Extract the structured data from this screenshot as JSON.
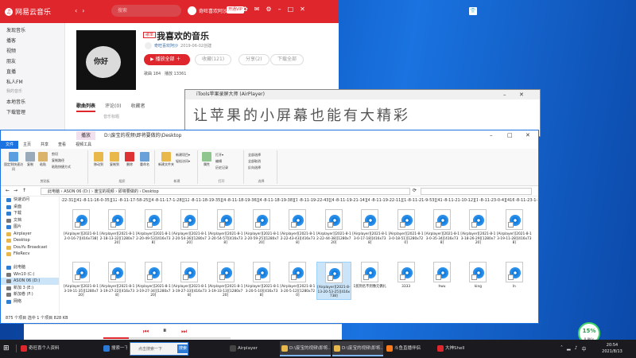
{
  "netease": {
    "app_name": "网易云音乐",
    "nav_back": "‹",
    "nav_fwd": "›",
    "search_placeholder": "搜索",
    "user_name": "奇旺喜欢阿沙",
    "vip": "开通VIP",
    "sidebar": [
      {
        "label": "发现音乐",
        "type": "item"
      },
      {
        "label": "播客",
        "type": "item"
      },
      {
        "label": "视频",
        "type": "item"
      },
      {
        "label": "朋友",
        "type": "item"
      },
      {
        "label": "直播",
        "type": "item"
      },
      {
        "label": "私人FM",
        "type": "item"
      },
      {
        "label": "我的音乐",
        "type": "head"
      },
      {
        "label": "本地音乐",
        "type": "item"
      },
      {
        "label": "下载管理",
        "type": "item"
      }
    ],
    "playlist_badge": "歌单",
    "playlist_title": "我喜欢的音乐",
    "cover_text": "你好",
    "creator": "奇旺喜欢阿沙",
    "create_date": "2019-06-02创建",
    "play_all": "播放全部",
    "collect": "收藏(121)",
    "share": "分享(2)",
    "download_all": "下载全部",
    "stats_songs_label": "歌曲",
    "stats_songs": "184",
    "stats_plays_label": "播放",
    "stats_plays": "13361",
    "tabs": [
      "歌曲列表",
      "评论(0)",
      "收藏者"
    ],
    "sub": "音乐标题"
  },
  "itools": {
    "title": "iTools苹果录屏大师 (AirPlayer)",
    "banner": "让苹果的小屏幕也能有大精彩"
  },
  "explorer": {
    "title_tag": "播放",
    "title_path": "D:\\废宝的视频\\即将要做的\\Desktop",
    "tabs": [
      "文件",
      "主页",
      "共享",
      "查看",
      "视频工具"
    ],
    "ribbon": {
      "clipboard_label": "剪贴板",
      "pin": "固定到快速访问",
      "copy": "复制",
      "paste": "粘贴",
      "cut": "剪切",
      "copy_path": "复制路径",
      "paste_shortcut": "粘贴快捷方式",
      "organize_label": "组织",
      "move_to": "移动到",
      "copy_to": "复制到",
      "delete": "删除",
      "rename": "重命名",
      "new_label": "新建",
      "new_folder": "新建文件夹",
      "new_item": "新建项目▾",
      "easy_access": "轻松访问▾",
      "open_label": "打开",
      "properties": "属性",
      "open": "打开▾",
      "edit": "编辑",
      "history": "历史记录",
      "select_label": "选择",
      "select_all": "全部选择",
      "select_none": "全部取消",
      "invert": "反向选择"
    },
    "breadcrumb": [
      "此电脑",
      "ASON 06 (D:)",
      "废宝的视频",
      "即将要做的",
      "Desktop"
    ],
    "nav": [
      {
        "label": "快速访问",
        "color": "#2d7fd3"
      },
      {
        "label": "桌面",
        "color": "#2d7fd3"
      },
      {
        "label": "下载",
        "color": "#2d7fd3"
      },
      {
        "label": "文档",
        "color": "#777"
      },
      {
        "label": "图片",
        "color": "#2d7fd3"
      },
      {
        "label": "Airplayer",
        "color": "#e8b84a"
      },
      {
        "label": "Desktop",
        "color": "#e8b84a"
      },
      {
        "label": "DouYu Broadcast",
        "color": "#e8b84a"
      },
      {
        "label": "FileRecv",
        "color": "#e8b84a"
      },
      {
        "label": "",
        "color": "transparent"
      },
      {
        "label": "此电脑",
        "color": "#2d7fd3"
      },
      {
        "label": "Win10 (C:)",
        "color": "#777"
      },
      {
        "label": "ASON 06 (D:)",
        "color": "#777"
      },
      {
        "label": "新加 3 (E:)",
        "color": "#777"
      },
      {
        "label": "新加卷 (F:)",
        "color": "#777"
      },
      {
        "label": "网络",
        "color": "#2d7fd3"
      }
    ],
    "top_row": [
      "-8-11-0-22-31][416x738]",
      "-8-11-16-0-35][1280x720]",
      "-8-11-17-58-25][416x738]",
      "-8-11-17-1-28][1280x720]",
      "-8-11-18-19-35][416x738]",
      "-8-11-18-19-36][416x738]",
      "-8-11-18-19-38][1280x720]",
      "-8-11-19-22-43][416x738]",
      "-8-11-19-21-14][416x738]",
      "-8-11-19-22-11][1280x720]",
      "-8-11-21-9-53][416x738]",
      "-8-11-21-10-12][1280x720]",
      "-8-11-23-0-4][416x738]",
      "-8-11-23-1-10][1280x720]"
    ],
    "row1": [
      "[Airplayer][2021-8-12-0-16-7][416x738]",
      "[Airplayer][2021-8-12-18-13-32][1280x720]",
      "[Airplayer][2021-8-12-20-49-53][416x738]",
      "[Airplayer][2021-8-12-20-54-36][1280x720]",
      "[Airplayer][2021-8-12-20-54-57][416x738]",
      "[Airplayer][2021-8-12-20-59-25][1280x720]",
      "[Airplayer][2021-8-12-22-43-43][416x738]",
      "[Airplayer][2021-8-12-22-44-38][1280x720]",
      "[Airplayer][2021-8-13-0-17-18][416x738]",
      "[Airplayer][2021-8-13-0-18-51][1280x720]",
      "[Airplayer][2021-8-13-0-35-34][416x738]",
      "[Airplayer][2021-8-13-18-26-29][1280x720]",
      "[Airplayer][2021-8-13-19-11-28][416x738]"
    ],
    "row2": [
      "[Airplayer][2021-8-13-19-11-35][1280x720]",
      "[Airplayer][2021-8-13-19-27-22][416x738]",
      "[Airplayer][2021-8-13-19-27-34][1280x720]",
      "[Airplayer][2021-8-13-19-27-33][416x738]",
      "[Airplayer][2021-8-13-19-33-13][1280x720]",
      "[Airplayer][2021-8-13-20-5-10][416x738]",
      "[Airplayer][2021-8-13-20-5-12][1280x720]",
      "[Airplayer][2021-8-13-20-53-25][416x738]",
      "1剪到名不到像元偶扎",
      "3333",
      "hwu",
      "king",
      "ln"
    ],
    "status": "875 个项目    选中 1 个项目  828 KB"
  },
  "taskbar": {
    "start": "⊞",
    "items": [
      {
        "label": "奇旺喜个人资料",
        "color": "#e0262d"
      },
      {
        "label": "搜索一下",
        "color": "#2b7bd6"
      },
      {
        "label": "Airplayer",
        "color": "#444"
      },
      {
        "label": "D:\\废宝的视频\\即将...",
        "color": "#e8b84a"
      },
      {
        "label": "D:\\废宝的视频\\即将...",
        "color": "#e8b84a"
      },
      {
        "label": "斗鱼直播伴侣",
        "color": "#ff7a1a"
      },
      {
        "label": "大神Shell",
        "color": "#e0262d"
      }
    ],
    "search_placeholder": "点击搜索一下",
    "search_btn": "搜索",
    "time": "20:54",
    "date": "2021/8/13"
  },
  "speed": {
    "percent": "15%",
    "up": "0.8K/s",
    "down": "1.4K/s"
  }
}
